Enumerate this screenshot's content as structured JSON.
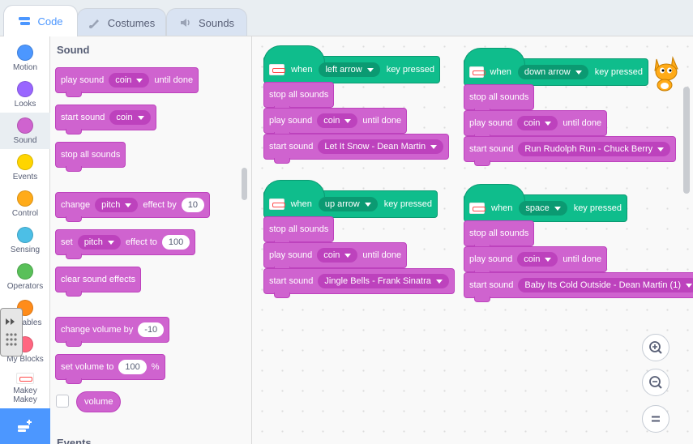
{
  "tabs": {
    "code": "Code",
    "costumes": "Costumes",
    "sounds": "Sounds"
  },
  "categories": [
    {
      "label": "Motion",
      "color": "#4c97ff"
    },
    {
      "label": "Looks",
      "color": "#9966ff"
    },
    {
      "label": "Sound",
      "color": "#cf63cf"
    },
    {
      "label": "Events",
      "color": "#ffd500"
    },
    {
      "label": "Control",
      "color": "#ffab19"
    },
    {
      "label": "Sensing",
      "color": "#4cbfe6"
    },
    {
      "label": "Operators",
      "color": "#59c059"
    },
    {
      "label": "Variables",
      "color": "#ff8c1a"
    },
    {
      "label": "My Blocks",
      "color": "#ff6680"
    },
    {
      "label": "Makey Makey",
      "icon": "makey-makey-icon"
    }
  ],
  "palette": {
    "heading": "Sound",
    "next_heading": "Events",
    "play_sound": {
      "label": "play sound",
      "sound": "coin",
      "suffix": "until done"
    },
    "start_sound": {
      "label": "start sound",
      "sound": "coin"
    },
    "stop_all": "stop all sounds",
    "change_effect": {
      "label": "change",
      "effect": "pitch",
      "middle": "effect by",
      "value": "10"
    },
    "set_effect": {
      "label": "set",
      "effect": "pitch",
      "middle": "effect to",
      "value": "100"
    },
    "clear_effects": "clear sound effects",
    "change_volume": {
      "label": "change volume by",
      "value": "-10"
    },
    "set_volume": {
      "label": "set volume to",
      "value": "100",
      "unit": "%"
    },
    "volume": "volume"
  },
  "scripts": [
    {
      "when": "when",
      "key": "left arrow",
      "pressed": "key pressed",
      "stop": "stop all sounds",
      "play": "play sound",
      "play_sound": "coin",
      "until": "until done",
      "start": "start sound",
      "song": "Let It Snow - Dean Martin"
    },
    {
      "when": "when",
      "key": "down arrow",
      "pressed": "key pressed",
      "stop": "stop all sounds",
      "play": "play sound",
      "play_sound": "coin",
      "until": "until done",
      "start": "start sound",
      "song": "Run Rudolph Run - Chuck Berry"
    },
    {
      "when": "when",
      "key": "up arrow",
      "pressed": "key pressed",
      "stop": "stop all sounds",
      "play": "play sound",
      "play_sound": "coin",
      "until": "until done",
      "start": "start sound",
      "song": "Jingle Bells - Frank Sinatra"
    },
    {
      "when": "when",
      "key": "space",
      "pressed": "key pressed",
      "stop": "stop all sounds",
      "play": "play sound",
      "play_sound": "coin",
      "until": "until done",
      "start": "start sound",
      "song": "Baby Its Cold Outside - Dean Martin (1)"
    }
  ],
  "colors": {
    "sound": "#cf63cf",
    "event_green": "#0fbd8c",
    "accent": "#4c97ff"
  }
}
